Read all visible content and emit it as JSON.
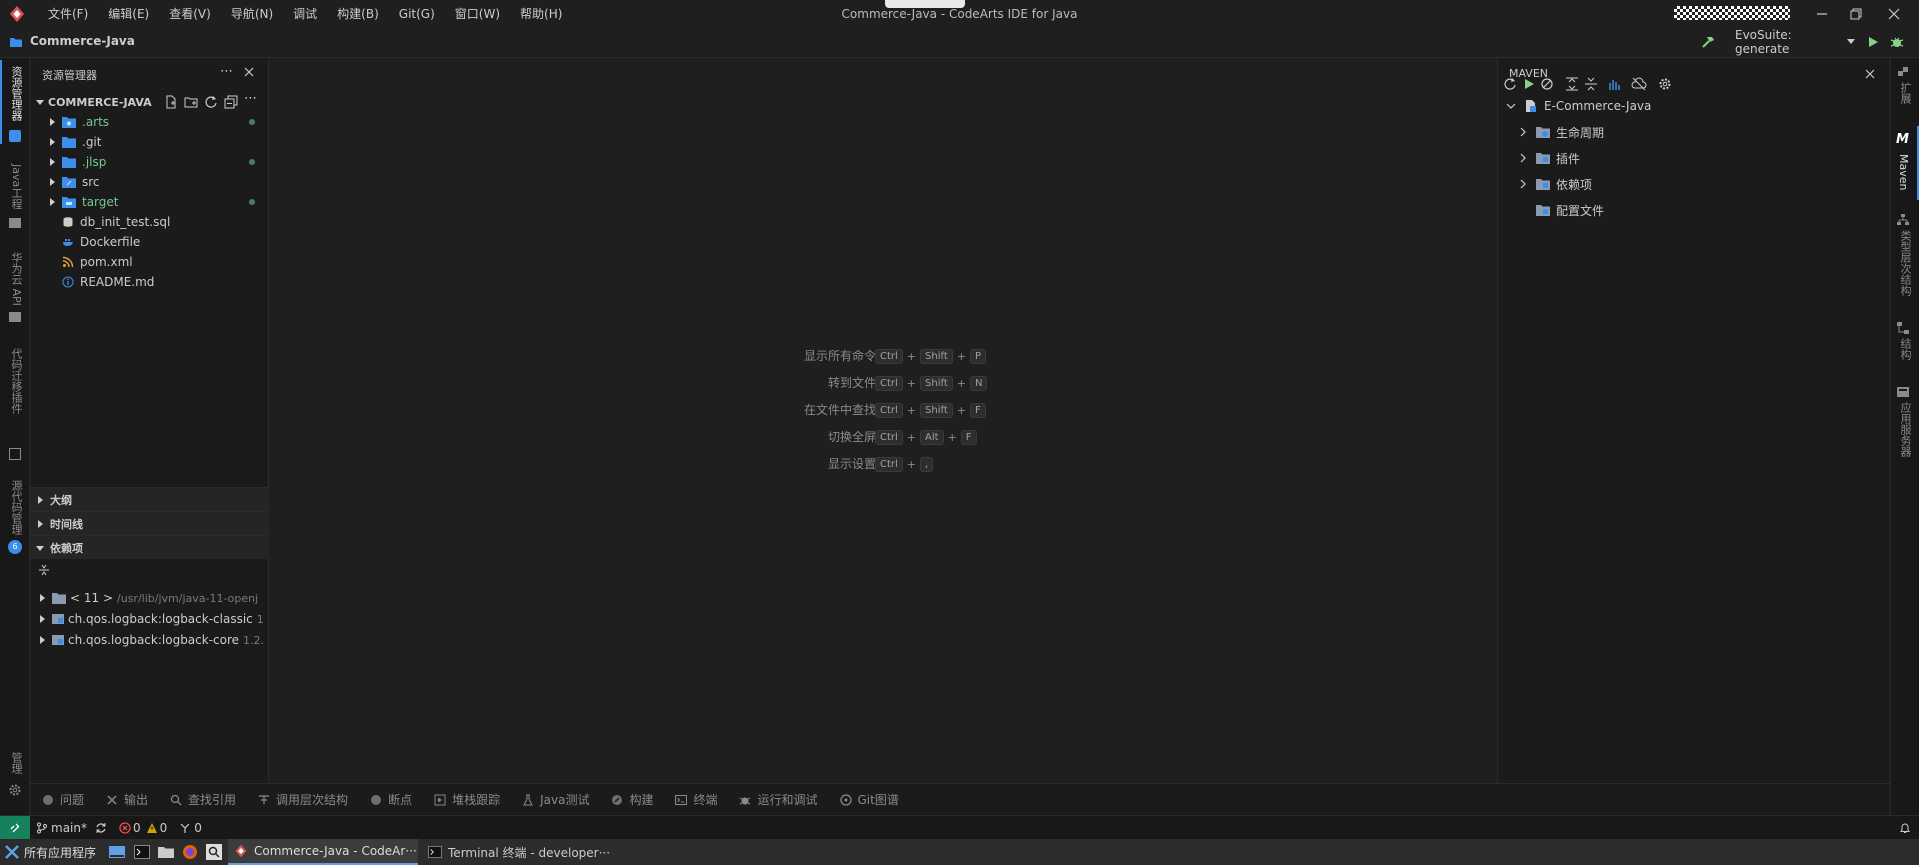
{
  "titlebar": {
    "menus": [
      "文件(F)",
      "编辑(E)",
      "查看(V)",
      "导航(N)",
      "调试",
      "构建(B)",
      "Git(G)",
      "窗口(W)",
      "帮助(H)"
    ],
    "title": "Commerce-Java - CodeArts IDE for Java"
  },
  "projbar": {
    "project_name": "Commerce-Java",
    "run_config": "EvoSuite: generate"
  },
  "left_activity": {
    "items": [
      "资源管理器",
      "Java工程",
      "华为云 API",
      "代码迁移插件",
      "源代码管理",
      "管理"
    ]
  },
  "right_activity": {
    "items": [
      "扩展",
      "Maven",
      "类型层次结构",
      "结构",
      "应用服务器"
    ]
  },
  "explorer": {
    "title": "资源管理器",
    "root": "COMMERCE-JAVA",
    "items": [
      {
        "name": ".arts",
        "type": "folder",
        "color": "#73c991"
      },
      {
        "name": ".git",
        "type": "folder",
        "color": "#cccccc"
      },
      {
        "name": ".jlsp",
        "type": "folder",
        "color": "#73c991"
      },
      {
        "name": "src",
        "type": "folder",
        "color": "#cccccc"
      },
      {
        "name": "target",
        "type": "folder",
        "color": "#73c991"
      },
      {
        "name": "db_init_test.sql",
        "type": "file",
        "color": "#cccccc"
      },
      {
        "name": "Dockerfile",
        "type": "file",
        "color": "#cccccc"
      },
      {
        "name": "pom.xml",
        "type": "file",
        "color": "#cccccc"
      },
      {
        "name": "README.md",
        "type": "file",
        "color": "#cccccc"
      }
    ],
    "sections": {
      "outline": "大纲",
      "timeline": "时间线",
      "dependencies": "依赖项"
    },
    "deps": [
      {
        "name": "< 11 >",
        "detail": "/usr/lib/jvm/java-11-openj"
      },
      {
        "name": "ch.qos.logback:logback-classic",
        "detail": "1"
      },
      {
        "name": "ch.qos.logback:logback-core",
        "detail": "1.2."
      }
    ]
  },
  "editor": {
    "hints": [
      {
        "label": "显示所有命令",
        "keys": [
          "Ctrl",
          "Shift",
          "P"
        ]
      },
      {
        "label": "转到文件",
        "keys": [
          "Ctrl",
          "Shift",
          "N"
        ]
      },
      {
        "label": "在文件中查找",
        "keys": [
          "Ctrl",
          "Shift",
          "F"
        ]
      },
      {
        "label": "切换全屏",
        "keys": [
          "Ctrl",
          "Alt",
          "F"
        ]
      },
      {
        "label": "显示设置",
        "keys": [
          "Ctrl",
          ","
        ]
      }
    ]
  },
  "maven": {
    "title": "MAVEN",
    "project": "E-Commerce-Java",
    "children": [
      "生命周期",
      "插件",
      "依赖项",
      "配置文件"
    ]
  },
  "bottom_tabs": [
    "问题",
    "输出",
    "查找引用",
    "调用层次结构",
    "断点",
    "堆栈跟踪",
    "Java测试",
    "构建",
    "终端",
    "运行和调试",
    "Git图谱"
  ],
  "statusbar": {
    "branch": "main*",
    "errors": "0",
    "warnings": "0",
    "ports": "0"
  },
  "taskbar": {
    "apps_label": "所有应用程序",
    "windows": [
      "Commerce-Java - CodeAr···",
      "Terminal 终端 - developer···"
    ]
  }
}
